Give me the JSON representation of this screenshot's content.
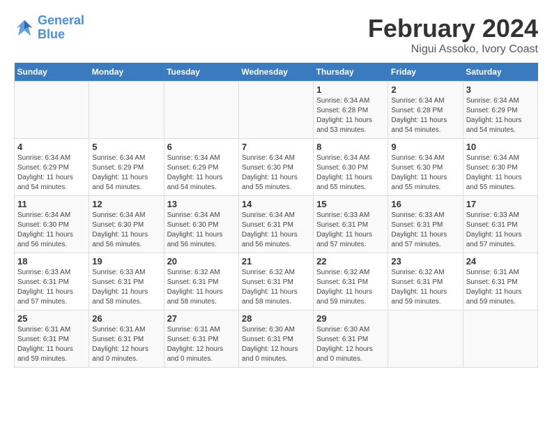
{
  "header": {
    "logo_line1": "General",
    "logo_line2": "Blue",
    "title": "February 2024",
    "subtitle": "Nigui Assoko, Ivory Coast"
  },
  "weekdays": [
    "Sunday",
    "Monday",
    "Tuesday",
    "Wednesday",
    "Thursday",
    "Friday",
    "Saturday"
  ],
  "weeks": [
    [
      {
        "day": "",
        "info": ""
      },
      {
        "day": "",
        "info": ""
      },
      {
        "day": "",
        "info": ""
      },
      {
        "day": "",
        "info": ""
      },
      {
        "day": "1",
        "info": "Sunrise: 6:34 AM\nSunset: 6:28 PM\nDaylight: 11 hours\nand 53 minutes."
      },
      {
        "day": "2",
        "info": "Sunrise: 6:34 AM\nSunset: 6:28 PM\nDaylight: 11 hours\nand 54 minutes."
      },
      {
        "day": "3",
        "info": "Sunrise: 6:34 AM\nSunset: 6:29 PM\nDaylight: 11 hours\nand 54 minutes."
      }
    ],
    [
      {
        "day": "4",
        "info": "Sunrise: 6:34 AM\nSunset: 6:29 PM\nDaylight: 11 hours\nand 54 minutes."
      },
      {
        "day": "5",
        "info": "Sunrise: 6:34 AM\nSunset: 6:29 PM\nDaylight: 11 hours\nand 54 minutes."
      },
      {
        "day": "6",
        "info": "Sunrise: 6:34 AM\nSunset: 6:29 PM\nDaylight: 11 hours\nand 54 minutes."
      },
      {
        "day": "7",
        "info": "Sunrise: 6:34 AM\nSunset: 6:30 PM\nDaylight: 11 hours\nand 55 minutes."
      },
      {
        "day": "8",
        "info": "Sunrise: 6:34 AM\nSunset: 6:30 PM\nDaylight: 11 hours\nand 55 minutes."
      },
      {
        "day": "9",
        "info": "Sunrise: 6:34 AM\nSunset: 6:30 PM\nDaylight: 11 hours\nand 55 minutes."
      },
      {
        "day": "10",
        "info": "Sunrise: 6:34 AM\nSunset: 6:30 PM\nDaylight: 11 hours\nand 55 minutes."
      }
    ],
    [
      {
        "day": "11",
        "info": "Sunrise: 6:34 AM\nSunset: 6:30 PM\nDaylight: 11 hours\nand 56 minutes."
      },
      {
        "day": "12",
        "info": "Sunrise: 6:34 AM\nSunset: 6:30 PM\nDaylight: 11 hours\nand 56 minutes."
      },
      {
        "day": "13",
        "info": "Sunrise: 6:34 AM\nSunset: 6:30 PM\nDaylight: 11 hours\nand 56 minutes."
      },
      {
        "day": "14",
        "info": "Sunrise: 6:34 AM\nSunset: 6:31 PM\nDaylight: 11 hours\nand 56 minutes."
      },
      {
        "day": "15",
        "info": "Sunrise: 6:33 AM\nSunset: 6:31 PM\nDaylight: 11 hours\nand 57 minutes."
      },
      {
        "day": "16",
        "info": "Sunrise: 6:33 AM\nSunset: 6:31 PM\nDaylight: 11 hours\nand 57 minutes."
      },
      {
        "day": "17",
        "info": "Sunrise: 6:33 AM\nSunset: 6:31 PM\nDaylight: 11 hours\nand 57 minutes."
      }
    ],
    [
      {
        "day": "18",
        "info": "Sunrise: 6:33 AM\nSunset: 6:31 PM\nDaylight: 11 hours\nand 57 minutes."
      },
      {
        "day": "19",
        "info": "Sunrise: 6:33 AM\nSunset: 6:31 PM\nDaylight: 11 hours\nand 58 minutes."
      },
      {
        "day": "20",
        "info": "Sunrise: 6:32 AM\nSunset: 6:31 PM\nDaylight: 11 hours\nand 58 minutes."
      },
      {
        "day": "21",
        "info": "Sunrise: 6:32 AM\nSunset: 6:31 PM\nDaylight: 11 hours\nand 58 minutes."
      },
      {
        "day": "22",
        "info": "Sunrise: 6:32 AM\nSunset: 6:31 PM\nDaylight: 11 hours\nand 59 minutes."
      },
      {
        "day": "23",
        "info": "Sunrise: 6:32 AM\nSunset: 6:31 PM\nDaylight: 11 hours\nand 59 minutes."
      },
      {
        "day": "24",
        "info": "Sunrise: 6:31 AM\nSunset: 6:31 PM\nDaylight: 11 hours\nand 59 minutes."
      }
    ],
    [
      {
        "day": "25",
        "info": "Sunrise: 6:31 AM\nSunset: 6:31 PM\nDaylight: 11 hours\nand 59 minutes."
      },
      {
        "day": "26",
        "info": "Sunrise: 6:31 AM\nSunset: 6:31 PM\nDaylight: 12 hours\nand 0 minutes."
      },
      {
        "day": "27",
        "info": "Sunrise: 6:31 AM\nSunset: 6:31 PM\nDaylight: 12 hours\nand 0 minutes."
      },
      {
        "day": "28",
        "info": "Sunrise: 6:30 AM\nSunset: 6:31 PM\nDaylight: 12 hours\nand 0 minutes."
      },
      {
        "day": "29",
        "info": "Sunrise: 6:30 AM\nSunset: 6:31 PM\nDaylight: 12 hours\nand 0 minutes."
      },
      {
        "day": "",
        "info": ""
      },
      {
        "day": "",
        "info": ""
      }
    ]
  ]
}
